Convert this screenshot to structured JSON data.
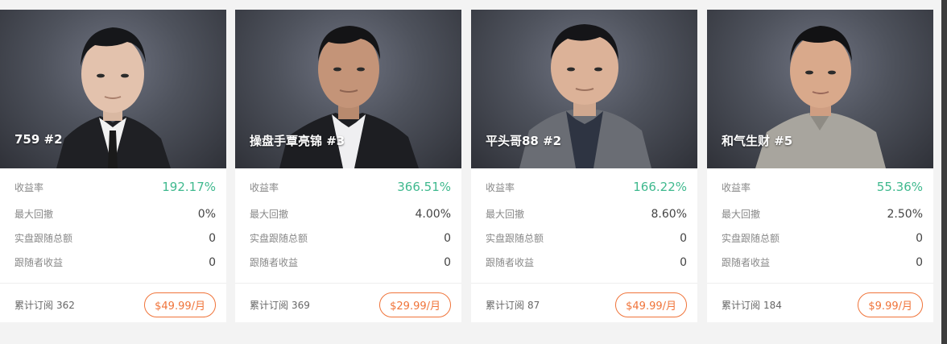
{
  "cards": [
    {
      "name": "759 #2",
      "return_label": "收益率",
      "return_value": "192.17%",
      "drawdown_label": "最大回撤",
      "drawdown_value": "0%",
      "follow_total_label": "实盘跟随总额",
      "follow_total_value": "0",
      "follower_profit_label": "跟随者收益",
      "follower_profit_value": "0",
      "subs_label": "累计订阅",
      "subs_count": "362",
      "price": "$49.99/月"
    },
    {
      "name": "操盘手覃亮锦 #3",
      "return_label": "收益率",
      "return_value": "366.51%",
      "drawdown_label": "最大回撤",
      "drawdown_value": "4.00%",
      "follow_total_label": "实盘跟随总额",
      "follow_total_value": "0",
      "follower_profit_label": "跟随者收益",
      "follower_profit_value": "0",
      "subs_label": "累计订阅",
      "subs_count": "369",
      "price": "$29.99/月"
    },
    {
      "name": "平头哥88 #2",
      "return_label": "收益率",
      "return_value": "166.22%",
      "drawdown_label": "最大回撤",
      "drawdown_value": "8.60%",
      "follow_total_label": "实盘跟随总额",
      "follow_total_value": "0",
      "follower_profit_label": "跟随者收益",
      "follower_profit_value": "0",
      "subs_label": "累计订阅",
      "subs_count": "87",
      "price": "$49.99/月"
    },
    {
      "name": "和气生财 #5",
      "return_label": "收益率",
      "return_value": "55.36%",
      "drawdown_label": "最大回撤",
      "drawdown_value": "2.50%",
      "follow_total_label": "实盘跟随总额",
      "follow_total_value": "0",
      "follower_profit_label": "跟随者收益",
      "follower_profit_value": "0",
      "subs_label": "累计订阅",
      "subs_count": "184",
      "price": "$9.99/月"
    }
  ],
  "colors": {
    "positive": "#3fb98e",
    "price_accent": "#f0743a",
    "page_bg": "#f3f3f3"
  }
}
